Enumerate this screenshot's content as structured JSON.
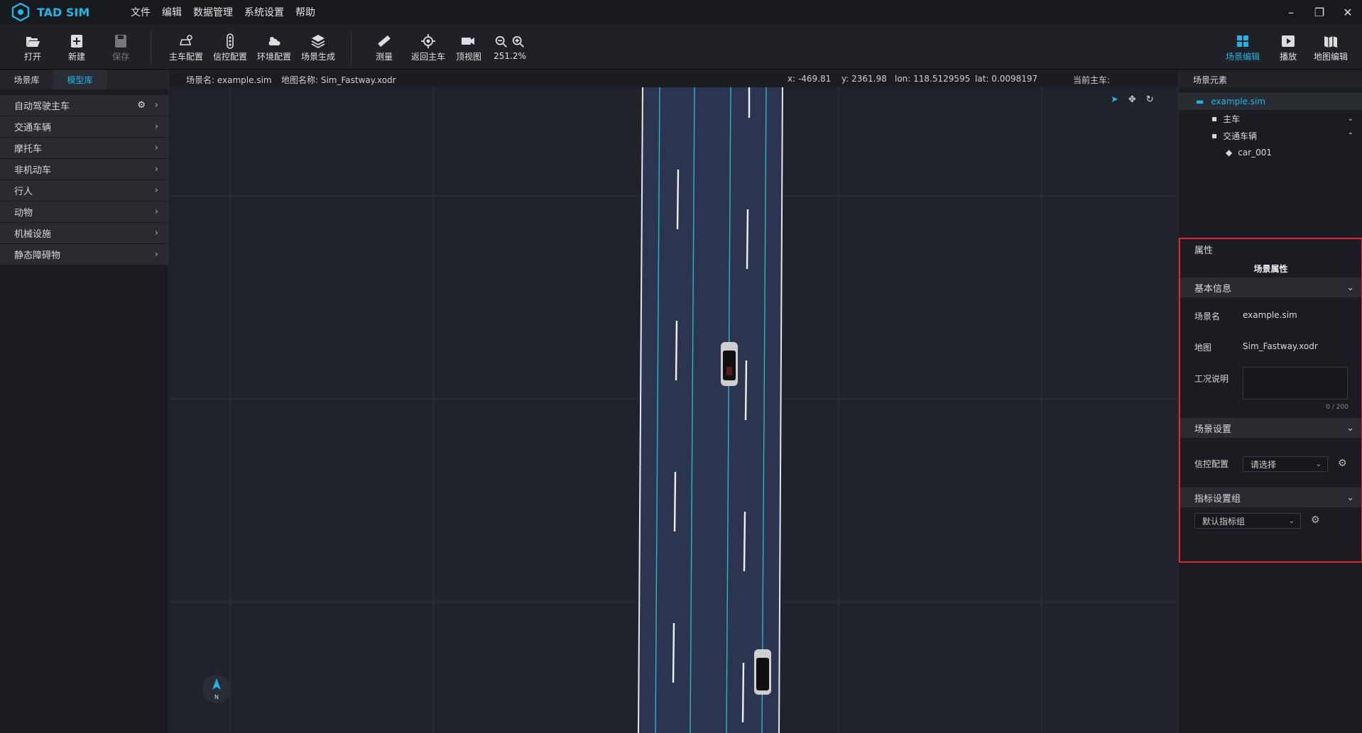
{
  "app": {
    "title": "TAD SIM"
  },
  "menu": [
    "文件",
    "编辑",
    "数据管理",
    "系统设置",
    "帮助"
  ],
  "toolbar": {
    "open": "打开",
    "new": "新建",
    "save": "保存",
    "ego_config": "主车配置",
    "signal_config": "信控配置",
    "env_config": "环境配置",
    "scene_gen": "场景生成",
    "measure": "测量",
    "return_ego": "返回主车",
    "top_view": "顶视图",
    "zoom": "251.2%",
    "scene_edit": "场景编辑",
    "play": "播放",
    "map_edit": "地图编辑"
  },
  "left": {
    "tabs": [
      "场景库",
      "模型库"
    ],
    "categories": [
      "自动驾驶主车",
      "交通车辆",
      "摩托车",
      "非机动车",
      "行人",
      "动物",
      "机械设施",
      "静态障碍物"
    ]
  },
  "infobar": {
    "scene": "场景名: example.sim",
    "map": "地图名称: Sim_Fastway.xodr",
    "x": "x: -469.81",
    "y": "y: 2361.98",
    "lon": "lon: 118.5129595",
    "lat": "lat: 0.0098197",
    "ego": "当前主车:"
  },
  "compass": "N",
  "right": {
    "elements_title": "场景元素",
    "tree": [
      "example.sim",
      "主车",
      "交通车辆",
      "car_001"
    ],
    "props_title": "属性",
    "scene_props": "场景属性",
    "basic_info": "基本信息",
    "scene_name_label": "场景名",
    "scene_name": "example.sim",
    "map_label": "地图",
    "map_value": "Sim_Fastway.xodr",
    "desc_label": "工况说明",
    "desc_count": "0 / 200",
    "scene_settings": "场景设置",
    "signal_label": "信控配置",
    "signal_placeholder": "请选择",
    "metrics_group": "指标设置组",
    "metrics_default": "默认指标组"
  }
}
